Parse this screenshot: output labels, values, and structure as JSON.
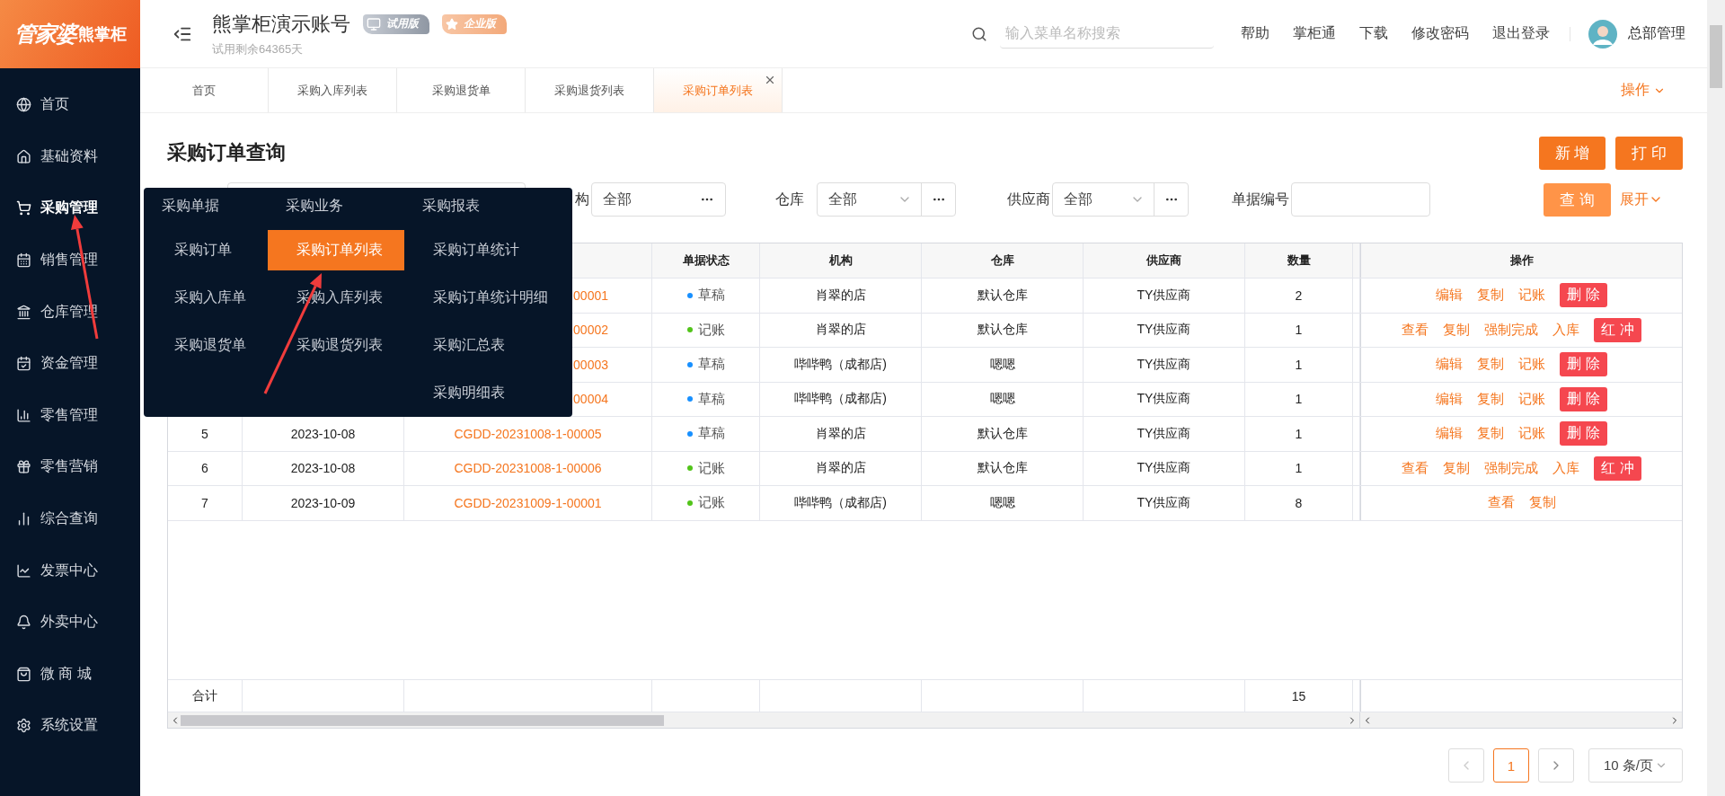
{
  "logo": {
    "brand": "管家婆",
    "product": "熊掌柜"
  },
  "header": {
    "account": "熊掌柜演示账号",
    "badges": [
      {
        "label": "试用版",
        "kind": "trial"
      },
      {
        "label": "企业版",
        "kind": "enterprise"
      }
    ],
    "subtitle": "试用剩余64365天",
    "search": {
      "placeholder": "输入菜单名称搜索"
    },
    "links": [
      "帮助",
      "掌柜通",
      "下载",
      "修改密码",
      "退出登录"
    ],
    "user": "总部管理"
  },
  "sidebar": {
    "items": [
      {
        "label": "首页",
        "selected": false
      },
      {
        "label": "基础资料",
        "selected": false
      },
      {
        "label": "采购管理",
        "selected": true
      },
      {
        "label": "销售管理",
        "selected": false
      },
      {
        "label": "仓库管理",
        "selected": false
      },
      {
        "label": "资金管理",
        "selected": false
      },
      {
        "label": "零售管理",
        "selected": false
      },
      {
        "label": "零售营销",
        "selected": false
      },
      {
        "label": "综合查询",
        "selected": false
      },
      {
        "label": "发票中心",
        "selected": false
      },
      {
        "label": "外卖中心",
        "selected": false
      },
      {
        "label": "微 商 城",
        "selected": false
      },
      {
        "label": "系统设置",
        "selected": false
      }
    ]
  },
  "tabs": [
    {
      "label": "首页",
      "selected": false
    },
    {
      "label": "采购入库列表",
      "selected": false
    },
    {
      "label": "采购退货单",
      "selected": false
    },
    {
      "label": "采购退货列表",
      "selected": false
    },
    {
      "label": "采购订单列表",
      "selected": true
    }
  ],
  "tab_actions": "操作",
  "page": {
    "title": "采购订单查询",
    "buttons": [
      "新 增",
      "打 印"
    ]
  },
  "filters": {
    "org": {
      "label": "构",
      "value": "全部"
    },
    "warehouse": {
      "label": "仓库",
      "value": "全部"
    },
    "supplier": {
      "label": "供应商",
      "value": "全部"
    },
    "order_no": {
      "label": "单据编号"
    },
    "search_button": "查 询",
    "expand": "展开"
  },
  "table": {
    "columns": [
      "单据状态",
      "机构",
      "仓库",
      "供应商",
      "数量"
    ],
    "action_column": "操作",
    "rows": [
      {
        "order_no": "00001",
        "status": {
          "text": "草稿",
          "color": "#1890ff"
        },
        "org": "肖翠的店",
        "warehouse": "默认仓库",
        "supplier": "TY供应商",
        "qty": "2",
        "actions": [
          {
            "label": "编辑",
            "kind": "link"
          },
          {
            "label": "复制",
            "kind": "link"
          },
          {
            "label": "记账",
            "kind": "link"
          },
          {
            "label": "删 除",
            "kind": "danger"
          }
        ]
      },
      {
        "order_no": "00002",
        "status": {
          "text": "记账",
          "color": "#52c41a"
        },
        "org": "肖翠的店",
        "warehouse": "默认仓库",
        "supplier": "TY供应商",
        "qty": "1",
        "actions": [
          {
            "label": "查看",
            "kind": "link"
          },
          {
            "label": "复制",
            "kind": "link"
          },
          {
            "label": "强制完成",
            "kind": "link"
          },
          {
            "label": "入库",
            "kind": "link"
          },
          {
            "label": "红 冲",
            "kind": "danger"
          }
        ]
      },
      {
        "order_no": "00003",
        "status": {
          "text": "草稿",
          "color": "#1890ff"
        },
        "org": "哔哔鸭（成都店)",
        "warehouse": "嗯嗯",
        "supplier": "TY供应商",
        "qty": "1",
        "actions": [
          {
            "label": "编辑",
            "kind": "link"
          },
          {
            "label": "复制",
            "kind": "link"
          },
          {
            "label": "记账",
            "kind": "link"
          },
          {
            "label": "删 除",
            "kind": "danger"
          }
        ]
      },
      {
        "order_no": "00004",
        "status": {
          "text": "草稿",
          "color": "#1890ff"
        },
        "org": "哔哔鸭（成都店)",
        "warehouse": "嗯嗯",
        "supplier": "TY供应商",
        "qty": "1",
        "actions": [
          {
            "label": "编辑",
            "kind": "link"
          },
          {
            "label": "复制",
            "kind": "link"
          },
          {
            "label": "记账",
            "kind": "link"
          },
          {
            "label": "删 除",
            "kind": "danger"
          }
        ]
      },
      {
        "index": "5",
        "date": "2023-10-08",
        "order_no": "CGDD-20231008-1-00005",
        "status": {
          "text": "草稿",
          "color": "#1890ff"
        },
        "org": "肖翠的店",
        "warehouse": "默认仓库",
        "supplier": "TY供应商",
        "qty": "1",
        "actions": [
          {
            "label": "编辑",
            "kind": "link"
          },
          {
            "label": "复制",
            "kind": "link"
          },
          {
            "label": "记账",
            "kind": "link"
          },
          {
            "label": "删 除",
            "kind": "danger"
          }
        ]
      },
      {
        "index": "6",
        "date": "2023-10-08",
        "order_no": "CGDD-20231008-1-00006",
        "status": {
          "text": "记账",
          "color": "#52c41a"
        },
        "org": "肖翠的店",
        "warehouse": "默认仓库",
        "supplier": "TY供应商",
        "qty": "1",
        "actions": [
          {
            "label": "查看",
            "kind": "link"
          },
          {
            "label": "复制",
            "kind": "link"
          },
          {
            "label": "强制完成",
            "kind": "link"
          },
          {
            "label": "入库",
            "kind": "link"
          },
          {
            "label": "红 冲",
            "kind": "danger"
          }
        ]
      },
      {
        "index": "7",
        "date": "2023-10-09",
        "order_no": "CGDD-20231009-1-00001",
        "status": {
          "text": "记账",
          "color": "#52c41a"
        },
        "org": "哔哔鸭（成都店)",
        "warehouse": "嗯嗯",
        "supplier": "TY供应商",
        "qty": "8",
        "actions": [
          {
            "label": "查看",
            "kind": "link"
          },
          {
            "label": "复制",
            "kind": "link"
          }
        ]
      }
    ],
    "totals": {
      "label": "合计",
      "qty": "15"
    }
  },
  "pagination": {
    "pages": [
      {
        "label": "1",
        "selected": true
      }
    ],
    "prev_disabled": true,
    "page_size": "10 条/页"
  },
  "menu": {
    "columns": [
      {
        "title": "采购单据",
        "items": [
          {
            "label": "采购订单",
            "selected": false
          },
          {
            "label": "采购入库单",
            "selected": false
          },
          {
            "label": "采购退货单",
            "selected": false
          }
        ]
      },
      {
        "title": "采购业务",
        "items": [
          {
            "label": "采购订单列表",
            "selected": true
          },
          {
            "label": "采购入库列表",
            "selected": false
          },
          {
            "label": "采购退货列表",
            "selected": false
          }
        ]
      },
      {
        "title": "采购报表",
        "items": [
          {
            "label": "采购订单统计",
            "selected": false
          },
          {
            "label": "采购订单统计明细",
            "selected": false
          },
          {
            "label": "采购汇总表",
            "selected": false
          },
          {
            "label": "采购明细表",
            "selected": false
          }
        ]
      }
    ]
  }
}
